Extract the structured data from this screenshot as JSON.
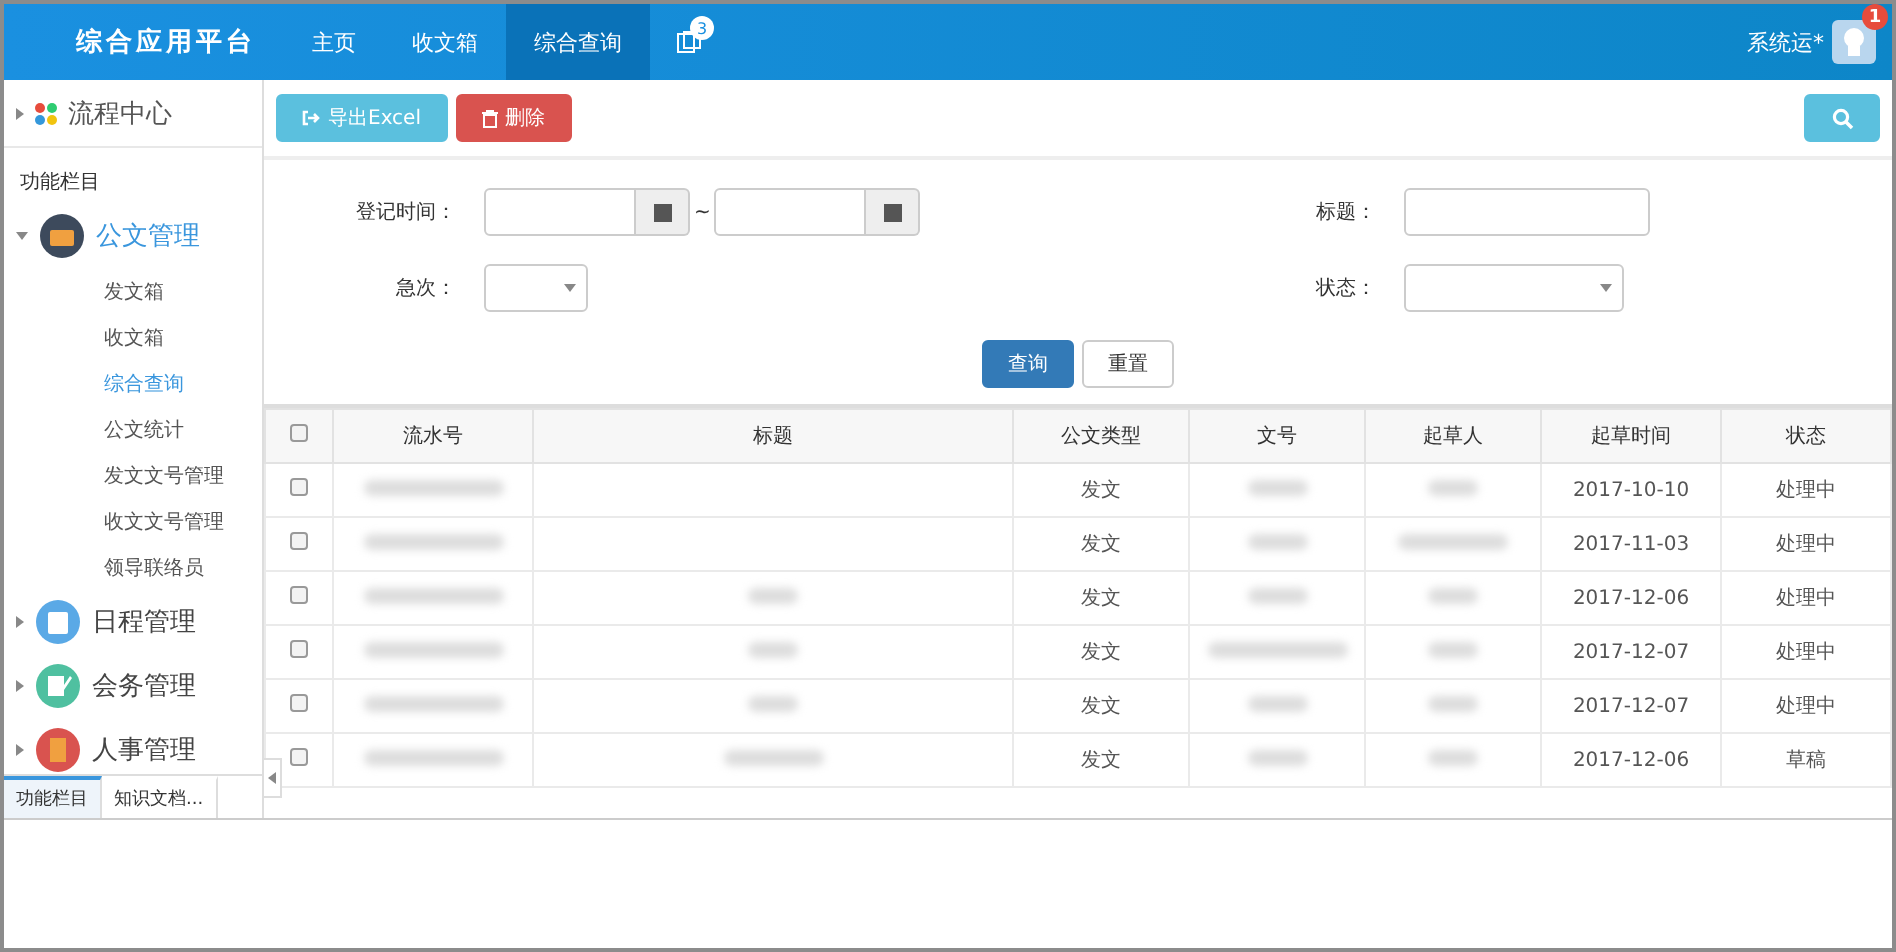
{
  "header": {
    "logo": "综合应用平台",
    "nav": [
      {
        "label": "主页",
        "selected": false
      },
      {
        "label": "收文箱",
        "selected": false
      },
      {
        "label": "综合查询",
        "selected": true
      }
    ],
    "nav_badge": "3",
    "user": "系统运*",
    "user_badge": "1"
  },
  "sidebar": {
    "top": {
      "label": "流程中心",
      "expanded": false
    },
    "section": "功能栏目",
    "groups": [
      {
        "label": "公文管理",
        "expanded": true,
        "children": [
          {
            "label": "发文箱",
            "selected": false
          },
          {
            "label": "收文箱",
            "selected": false
          },
          {
            "label": "综合查询",
            "selected": true
          },
          {
            "label": "公文统计",
            "selected": false
          },
          {
            "label": "发文文号管理",
            "selected": false
          },
          {
            "label": "收文文号管理",
            "selected": false
          },
          {
            "label": "领导联络员",
            "selected": false
          }
        ]
      },
      {
        "label": "日程管理",
        "expanded": false
      },
      {
        "label": "会务管理",
        "expanded": false
      },
      {
        "label": "人事管理",
        "expanded": false
      }
    ],
    "tabs": [
      {
        "label": "功能栏目",
        "selected": true
      },
      {
        "label": "知识文档...",
        "selected": false
      }
    ]
  },
  "toolbar": {
    "export": "导出Excel",
    "delete": "删除"
  },
  "filters": {
    "date_label": "登记时间：",
    "range_sep": "~",
    "title_label": "标题：",
    "urgency_label": "急次：",
    "status_label": "状态：",
    "query": "查询",
    "reset": "重置"
  },
  "table": {
    "select_all_checked": false,
    "columns": [
      "流水号",
      "标题",
      "公文类型",
      "文号",
      "起草人",
      "起草时间",
      "状态"
    ],
    "rows": [
      {
        "checked": false,
        "type": "发文",
        "time": "2017-10-10",
        "status": "处理中"
      },
      {
        "checked": false,
        "type": "发文",
        "time": "2017-11-03",
        "status": "处理中"
      },
      {
        "checked": false,
        "type": "发文",
        "time": "2017-12-06",
        "status": "处理中"
      },
      {
        "checked": false,
        "type": "发文",
        "time": "2017-12-07",
        "status": "处理中"
      },
      {
        "checked": false,
        "type": "发文",
        "time": "2017-12-07",
        "status": "处理中"
      },
      {
        "checked": false,
        "type": "发文",
        "time": "2017-12-06",
        "status": "草稿"
      }
    ]
  }
}
